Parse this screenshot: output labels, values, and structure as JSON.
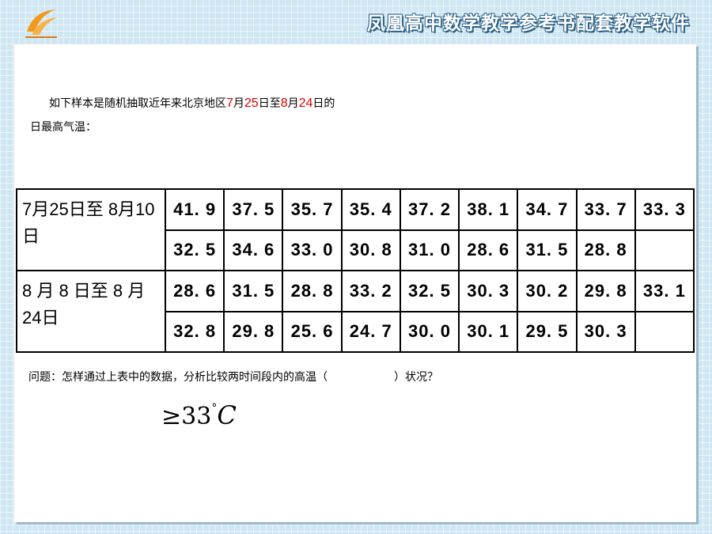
{
  "header": {
    "banner": "凤凰高中数学教学参考书配套教学软件",
    "logo_icon": "orange-swirl-logo"
  },
  "intro": {
    "line1_a": "如下样本是随机抽取近年来北京地区",
    "n1": "7",
    "t1": "月",
    "n2": "25",
    "t2": "日至",
    "n3": "8",
    "t3": "月",
    "n4": "24",
    "t4": "日的",
    "line2": "日最高气温："
  },
  "table": {
    "group1": {
      "label": "7月25日至 8月10日",
      "row1": [
        "41. 9",
        "37. 5",
        "35. 7",
        "35. 4",
        "37. 2",
        "38. 1",
        "34. 7",
        "33. 7",
        "33. 3"
      ],
      "row2": [
        "32. 5",
        "34. 6",
        "33. 0",
        "30. 8",
        "31. 0",
        "28. 6",
        "31. 5",
        "28. 8",
        ""
      ]
    },
    "group2": {
      "label": "8 月 8 日至 8 月 24日",
      "row1": [
        "28. 6",
        "31. 5",
        "28. 8",
        "33. 2",
        "32. 5",
        "30. 3",
        "30. 2",
        "29. 8",
        "33. 1"
      ],
      "row2": [
        "32. 8",
        "29. 8",
        "25. 6",
        "24. 7",
        "30. 0",
        "30. 1",
        "29. 5",
        "30. 3",
        ""
      ]
    }
  },
  "question": {
    "before": "问题：怎样通过上表中的数据，分析比较两时间段内的高温（",
    "after": "）状况？"
  },
  "formula": {
    "symbol": "≥33",
    "degree": "°",
    "unit": "C"
  }
}
